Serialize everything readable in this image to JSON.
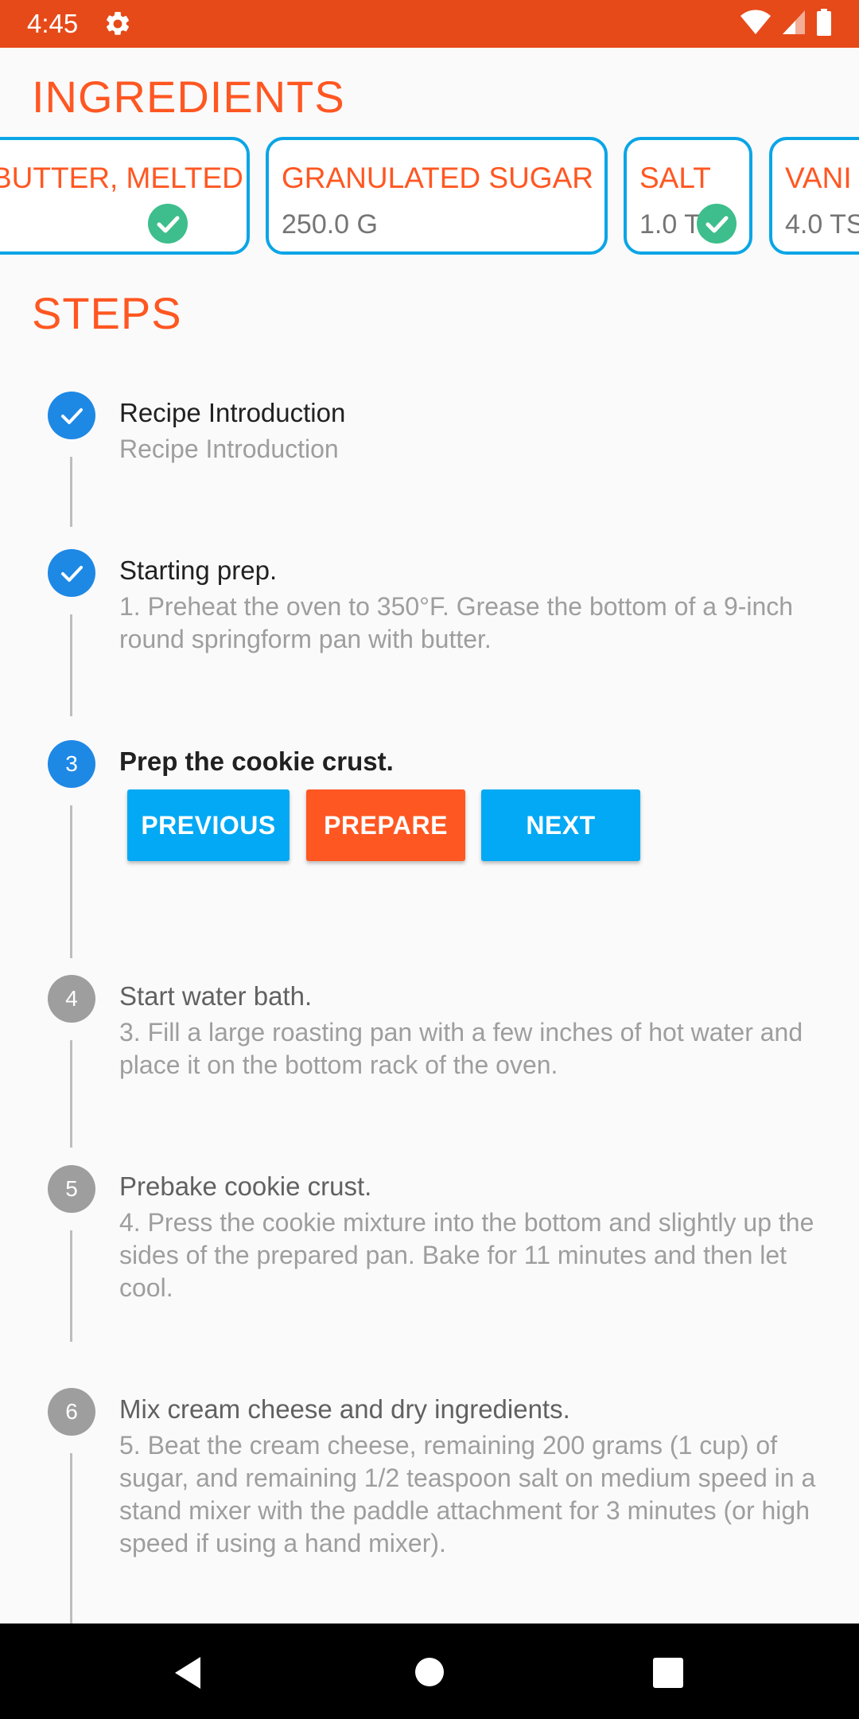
{
  "status": {
    "time": "4:45",
    "icons": [
      "gear-icon",
      "wifi-icon",
      "cell-signal-icon",
      "battery-icon"
    ]
  },
  "ingredients": {
    "title": "INGREDIENTS",
    "items": [
      {
        "name": "BUTTER, MELTED",
        "quantity": "",
        "checked": true
      },
      {
        "name": "GRANULATED SUGAR",
        "quantity": "250.0 G",
        "checked": false
      },
      {
        "name": "SALT",
        "quantity": "1.0 T",
        "checked": true
      },
      {
        "name": "VANI",
        "quantity": "4.0 TS",
        "checked": false
      }
    ]
  },
  "steps": {
    "title": "STEPS",
    "items": [
      {
        "number": "1",
        "state": "done",
        "title": "Recipe Introduction",
        "description": "Recipe Introduction"
      },
      {
        "number": "2",
        "state": "done",
        "title": "Starting prep.",
        "description": "1. Preheat the oven to 350°F. Grease the bottom of a 9-inch round springform pan with butter."
      },
      {
        "number": "3",
        "state": "active",
        "title": "Prep the cookie crust.",
        "description": ""
      },
      {
        "number": "4",
        "state": "todo",
        "title": "Start water bath.",
        "description": "3. Fill a large roasting pan with a few inches of hot water and place it on the bottom rack of the oven."
      },
      {
        "number": "5",
        "state": "todo",
        "title": "Prebake cookie crust.",
        "description": "4. Press the cookie mixture into the bottom and slightly up the sides of the prepared pan. Bake for 11 minutes and then let cool."
      },
      {
        "number": "6",
        "state": "todo",
        "title": "Mix cream cheese and dry ingredients.",
        "description": "5. Beat the cream cheese, remaining 200 grams (1 cup) of sugar, and remaining 1/2 teaspoon salt on medium speed in a stand mixer with the paddle attachment for 3 minutes (or high speed if using a hand mixer)."
      }
    ],
    "buttons": {
      "previous": "PREVIOUS",
      "prepare": "PREPARE",
      "next": "NEXT"
    }
  },
  "colors": {
    "status_bar": "#E64A19",
    "accent": "#FF5722",
    "card_border": "#0BA5E6",
    "step_active": "#1E88E5",
    "step_todo": "#9E9E9E",
    "check": "#3DBE8C"
  },
  "nav": {
    "icons": [
      "back-icon",
      "home-icon",
      "recents-icon"
    ]
  }
}
